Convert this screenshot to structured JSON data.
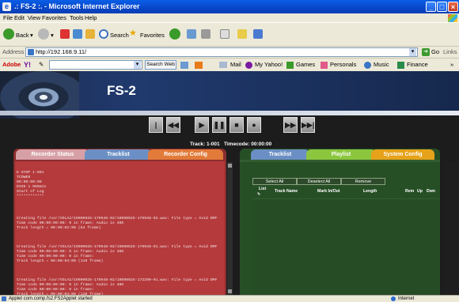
{
  "window": {
    "title": ".: FS-2 :. - Microsoft Internet Explorer",
    "app_icon": "ie-icon",
    "accent": "#0a5fe6"
  },
  "menu": [
    "File",
    "Edit",
    "View",
    "Favorites",
    "Tools",
    "Help"
  ],
  "toolbar": {
    "back": "Back",
    "search": "Search",
    "favorites": "Favorites"
  },
  "address": {
    "label": "Address",
    "url": "http://192.168.9.11/",
    "go": "Go",
    "links": "Links"
  },
  "yahoo": {
    "brand": "Adobe",
    "search_button": "Search Web",
    "links": [
      "Mail",
      "My Yahoo!",
      "Games",
      "Personals",
      "Music",
      "Finance"
    ]
  },
  "app": {
    "title": "FS-2",
    "track_label": "Track: 1-001",
    "timecode_label": "Timecode: 00:00:00",
    "transport": [
      "prev-track",
      "rewind",
      "play",
      "pause",
      "stop",
      "record",
      "fast-forward",
      "next-track"
    ]
  },
  "left_tabs": [
    {
      "label": "Recorder Status",
      "color": "#d6a0a6"
    },
    {
      "label": "Tracklist",
      "color": "#6b8fc4"
    },
    {
      "label": "Recorder Config",
      "color": "#e27b3a"
    }
  ],
  "log_lines": [
    "E  STOP 1-001",
    "TCOWER",
    "00:00:00:00",
    "DISK 1  95%min",
    "Start of Log",
    "************",
    "Creating file /usr/VOLA2/19090925-179948-02/19090925-179948-02.wav: File type = Avid OMF",
    "Time code 00:00:00:00: 0 in frame: Audio is 48K",
    "Track length = 00:00:02:00 (54 frame)",
    "Creating file /usr/VOLA2/19090925-179948-02/19090925-179948-01.wav: File type = Avid OMF",
    "Time code 00:00:00:00: 0 in frame: Audio is 48K",
    "Time code 00:00:00:00: 0 in frame:",
    "Track length = 00:00:04:00 (110 frame)",
    "Creating file /usr/VOLA2/19090925-179948-02/19090925-172290-01.wav: File type = Avid OMF",
    "Time code 00:00:00:00: 0 in frame: Audio is 48K",
    "Time code 00:00:00:00: 0 in frame:",
    "Track length = 00:00:04:00 (110 frame)",
    "Creating file /usr/VOLA2/19090925-179948-02/19090925-171711-01.wav: File type = Avid OMF",
    "Time code 00:00:00:00: 0 in frame: Audio is 48K",
    "Time code 00:00:00:00: 0 in frame:"
  ],
  "right_tabs": [
    {
      "label": "Tracklist",
      "color": "#6b8fc4",
      "text": "#ffffff"
    },
    {
      "label": "Playlist",
      "color": "#8cc63f",
      "text": "#ffffff"
    },
    {
      "label": "System Config",
      "color": "#e6a21a",
      "text": "#ffffff"
    }
  ],
  "playlist": {
    "buttons": [
      "Select All",
      "Deselect All",
      "Remove"
    ],
    "columns": [
      "List",
      "Track Name",
      "Mark In/Out",
      "Length",
      "Rem",
      "Up",
      "Dwn"
    ]
  },
  "status": {
    "text": "Applet com.comp.fs2.FS2Applet started",
    "zone": "Internet"
  }
}
